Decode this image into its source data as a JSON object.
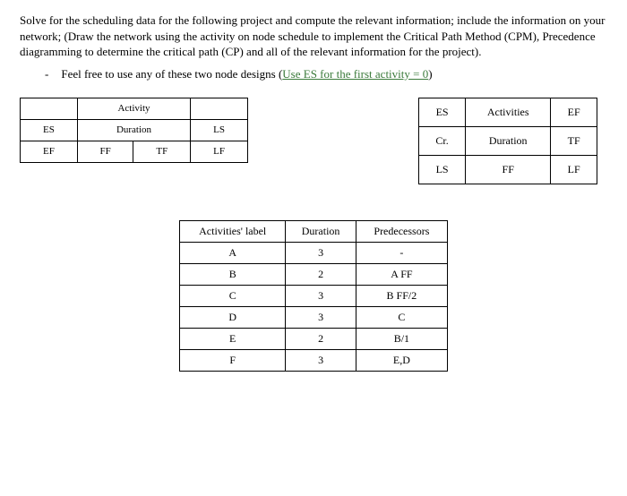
{
  "intro": "Solve for the scheduling data for the following project and compute the relevant information; include the information on your network; (Draw the network using the activity on node schedule to implement the Critical Path Method (CPM), Precedence diagramming to determine the critical path (CP) and all of the relevant information for the project).",
  "bullet": {
    "prefix": "Feel free to use any of these two node designs (",
    "green": "Use ES for the first activity = 0",
    "suffix": ")"
  },
  "nodeA": {
    "row1": {
      "c1": "",
      "c2": "Activity",
      "c3": ""
    },
    "row2": {
      "c1": "ES",
      "c2": "Duration",
      "c3": "LS"
    },
    "row3": {
      "c1": "EF",
      "c2a": "FF",
      "c2b": "TF",
      "c3": "LF"
    }
  },
  "nodeB": {
    "row1": {
      "c1": "ES",
      "c2": "Activities",
      "c3": "EF"
    },
    "row2": {
      "c1": "Cr.",
      "c2": "Duration",
      "c3": "TF"
    },
    "row3": {
      "c1": "LS",
      "c2": "FF",
      "c3": "LF"
    }
  },
  "activities": {
    "headers": {
      "label": "Activities' label",
      "duration": "Duration",
      "pred": "Predecessors"
    },
    "rows": [
      {
        "label": "A",
        "duration": "3",
        "pred": "-"
      },
      {
        "label": "B",
        "duration": "2",
        "pred": "A FF"
      },
      {
        "label": "C",
        "duration": "3",
        "pred": "B FF/2"
      },
      {
        "label": "D",
        "duration": "3",
        "pred": "C"
      },
      {
        "label": "E",
        "duration": "2",
        "pred": "B/1"
      },
      {
        "label": "F",
        "duration": "3",
        "pred": "E,D"
      }
    ]
  }
}
